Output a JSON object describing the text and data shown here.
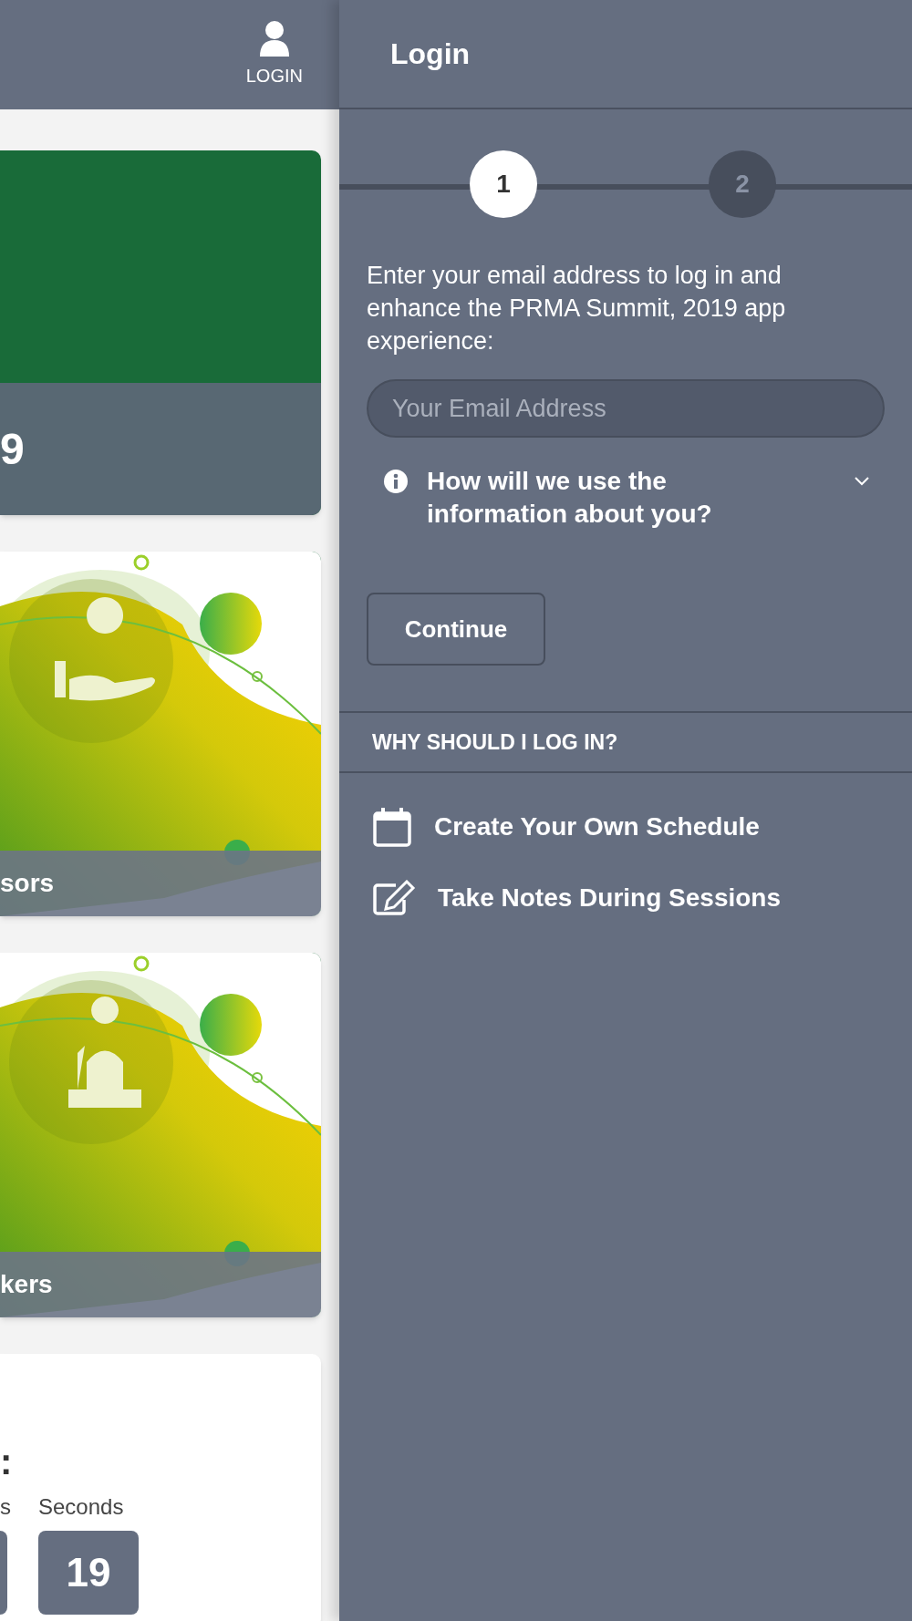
{
  "header": {
    "login_label": "LOGIN"
  },
  "cards": [
    {
      "kind": "plain",
      "caption": "9"
    },
    {
      "kind": "picture",
      "caption": "sors"
    },
    {
      "kind": "picture",
      "caption": "kers"
    }
  ],
  "countdown": {
    "separator": ":",
    "units": [
      {
        "label": "s"
      },
      {
        "label": "Seconds",
        "value": "19"
      }
    ]
  },
  "login_panel": {
    "title": "Login",
    "steps": [
      {
        "label": "1",
        "selected": true
      },
      {
        "label": "2",
        "selected": false
      }
    ],
    "intro": "Enter your email address to log in and enhance the PRMA Summit, 2019 app experience:",
    "email": {
      "placeholder": "Your Email Address"
    },
    "info": {
      "text": "How will we use the information about you?",
      "expanded": false
    },
    "continue": "Continue",
    "why_heading": "WHY SHOULD I LOG IN?",
    "benefits": [
      {
        "kind": "calendar",
        "text": "Create Your Own Schedule"
      },
      {
        "kind": "notes",
        "text": "Take Notes During Sessions"
      }
    ]
  }
}
